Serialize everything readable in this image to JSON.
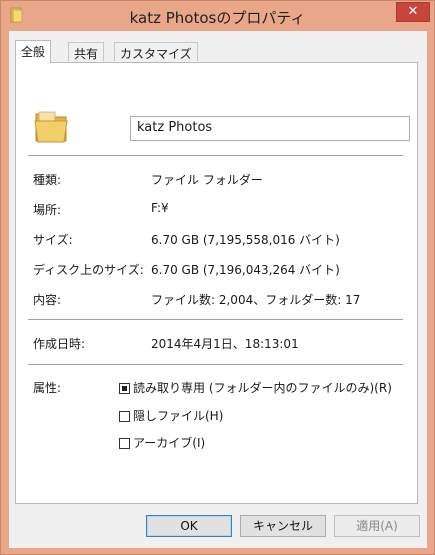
{
  "window": {
    "title": "katz Photosのプロパティ",
    "close_symbol": "✕"
  },
  "tabs": [
    {
      "label": "全般",
      "active": true
    },
    {
      "label": "共有",
      "active": false
    },
    {
      "label": "カスタマイズ",
      "active": false
    }
  ],
  "general": {
    "name": "katz Photos",
    "type_label": "種類:",
    "type_value": "ファイル フォルダー",
    "location_label": "場所:",
    "location_value": "F:¥",
    "size_label": "サイズ:",
    "size_value": "6.70 GB (7,195,558,016 バイト)",
    "disk_size_label": "ディスク上のサイズ:",
    "disk_size_value": "6.70 GB (7,196,043,264 バイト)",
    "contains_label": "内容:",
    "contains_value": "ファイル数: 2,004、フォルダー数: 17",
    "created_label": "作成日時:",
    "created_value": "2014年4月1日、18:13:01",
    "attributes_label": "属性:",
    "attributes": [
      {
        "label": "読み取り専用 (フォルダー内のファイルのみ)(R)",
        "checked": true
      },
      {
        "label": "隠しファイル(H)",
        "checked": false
      },
      {
        "label": "アーカイブ(I)",
        "checked": false
      }
    ]
  },
  "buttons": {
    "ok": "OK",
    "cancel": "キャンセル",
    "apply": "適用(A)"
  },
  "colors": {
    "frame": "#e9a689",
    "close_button": "#c7463b",
    "folder": "#f2cf6b"
  }
}
